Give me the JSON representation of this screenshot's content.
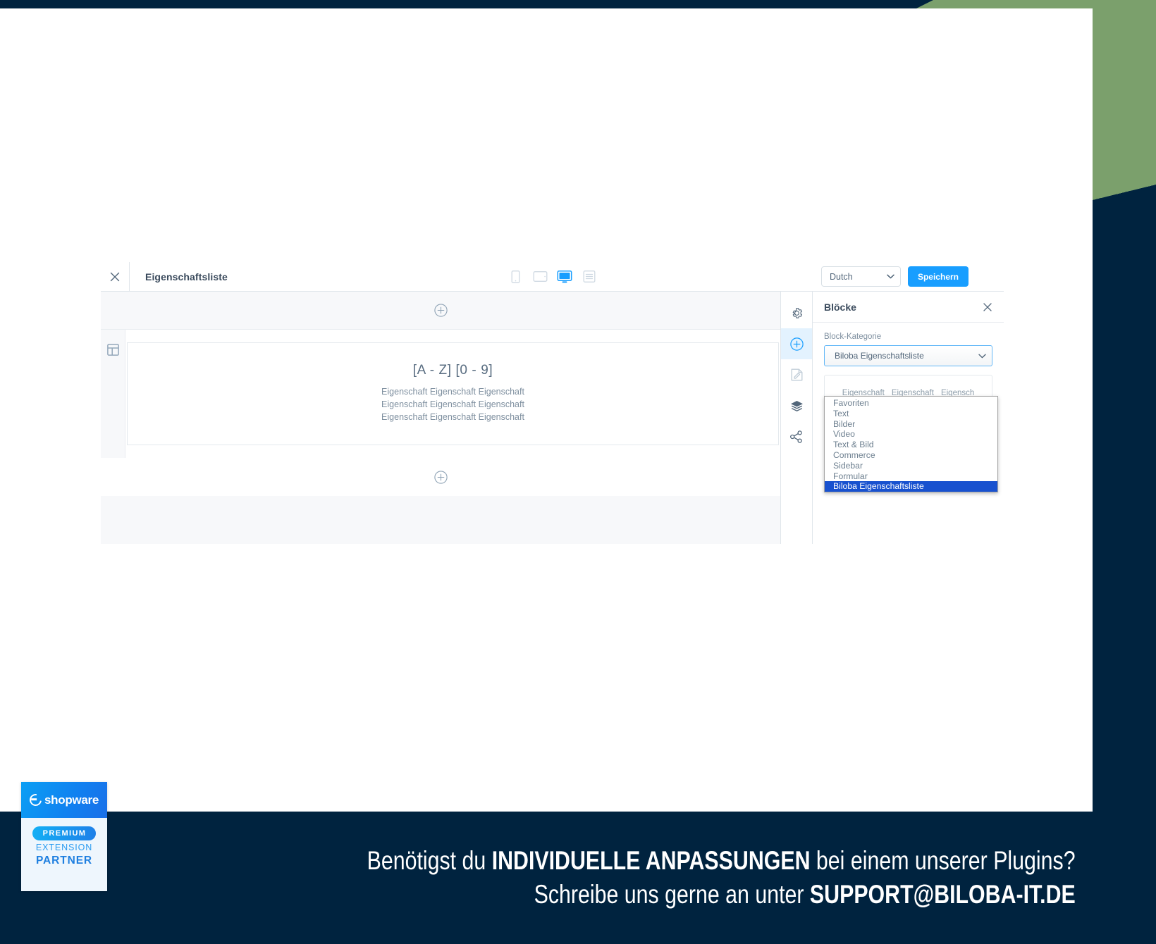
{
  "app": {
    "title": "Eigenschaftsliste",
    "close_icon": "close-icon",
    "device_views": [
      {
        "name": "mobile",
        "icon": "mobile-icon",
        "active": false
      },
      {
        "name": "tablet",
        "icon": "tablet-icon",
        "active": false
      },
      {
        "name": "desktop",
        "icon": "desktop-icon",
        "active": true
      },
      {
        "name": "form",
        "icon": "list-form-icon",
        "active": false
      }
    ],
    "language_select": {
      "value": "Dutch",
      "chevron_icon": "chevron-down-icon"
    },
    "save_label": "Speichern"
  },
  "canvas": {
    "section_icon": "layout-section-icon",
    "add_section_top_icon": "plus-circle-icon",
    "add_section_bottom_icon": "plus-circle-icon",
    "block": {
      "heading": "[A - Z] [0 - 9]",
      "rows": [
        "Eigenschaft Eigenschaft Eigenschaft",
        "Eigenschaft Eigenschaft Eigenschaft",
        "Eigenschaft Eigenschaft Eigenschaft"
      ]
    }
  },
  "rail": [
    {
      "name": "settings",
      "icon": "gear-icon",
      "active": false
    },
    {
      "name": "blocks",
      "icon": "plus-circle-icon",
      "active": true
    },
    {
      "name": "layout",
      "icon": "edit-document-icon",
      "active": false
    },
    {
      "name": "layers",
      "icon": "layers-icon",
      "active": false
    },
    {
      "name": "navigation",
      "icon": "share-nodes-icon",
      "active": false
    }
  ],
  "blocks_panel": {
    "title": "Blöcke",
    "close_icon": "close-icon",
    "category_label": "Block-Kategorie",
    "category_value": "Biloba Eigenschaftsliste",
    "category_chevron_icon": "chevron-down-icon",
    "category_options": [
      "Favoriten",
      "Text",
      "Bilder",
      "Video",
      "Text & Bild",
      "Commerce",
      "Sidebar",
      "Formular",
      "Biloba Eigenschaftsliste"
    ],
    "category_selected_index": 8,
    "block_preview": {
      "items": [
        "Eigenschaft",
        "Eigenschaft",
        "Eigensch"
      ],
      "label": "Biloba Eigenschaftsliste"
    }
  },
  "badge": {
    "logo_text": "shopware",
    "logo_icon": "shopware-logo-icon",
    "premium": "PREMIUM",
    "extension": "EXTENSION",
    "partner": "PARTNER"
  },
  "banner": {
    "line1_prefix": "Benötigst du ",
    "line1_strong": "INDIVIDUELLE ANPASSUNGEN",
    "line1_suffix": " bei einem unserer Plugins?",
    "line2_prefix": "Schreibe uns gerne an unter ",
    "line2_strong": "SUPPORT@BILOBA-IT.DE"
  },
  "colors": {
    "accent_blue": "#189eff",
    "frame_navy": "#00233f",
    "frame_green": "#7ba06c",
    "dropdown_selected": "#1851cf"
  }
}
